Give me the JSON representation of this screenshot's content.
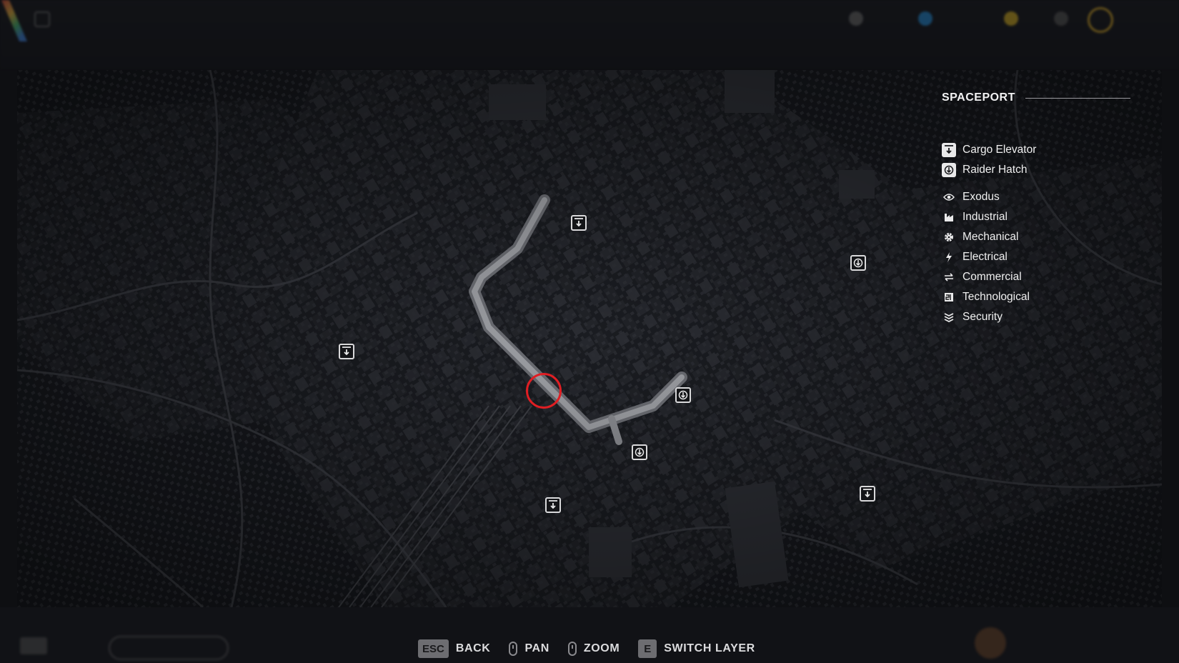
{
  "legend": {
    "title": "SPACEPORT",
    "access_points": [
      {
        "label": "Cargo Elevator",
        "icon": "cargo-elevator-icon"
      },
      {
        "label": "Raider Hatch",
        "icon": "raider-hatch-icon"
      }
    ],
    "categories": [
      {
        "label": "Exodus",
        "icon": "eye-icon"
      },
      {
        "label": "Industrial",
        "icon": "factory-icon"
      },
      {
        "label": "Mechanical",
        "icon": "gear-icon"
      },
      {
        "label": "Electrical",
        "icon": "lightning-icon"
      },
      {
        "label": "Commercial",
        "icon": "exchange-arrows-icon"
      },
      {
        "label": "Technological",
        "icon": "chip-icon"
      },
      {
        "label": "Security",
        "icon": "chevrons-icon"
      }
    ]
  },
  "hints": [
    {
      "key": "ESC",
      "label": "BACK"
    },
    {
      "key": "mouse",
      "label": "PAN"
    },
    {
      "key": "scroll",
      "label": "ZOOM"
    },
    {
      "key": "E",
      "label": "SWITCH LAYER"
    }
  ],
  "colors": {
    "player_marker": "#e01e23",
    "legend_text": "#f0f0f0",
    "map_bg": "#15171c"
  }
}
